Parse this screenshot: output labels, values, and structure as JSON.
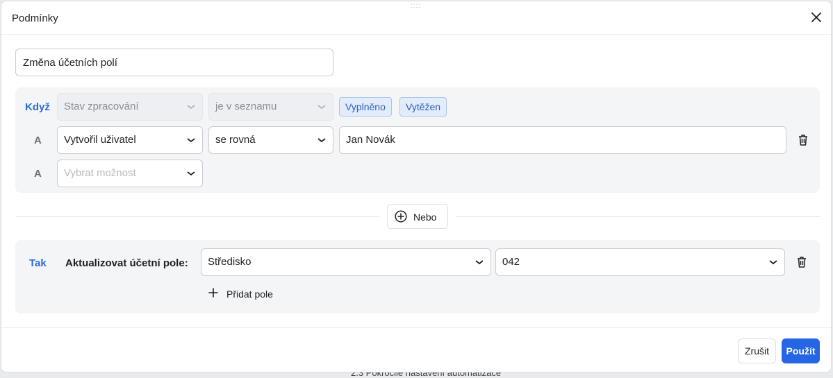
{
  "background": {
    "partial_text": "2.3 Pokročilé nastavení automatizace"
  },
  "dialog": {
    "title": "Podmínky",
    "rule_name": "Změna účetních polí"
  },
  "conditions": {
    "when_keyword": "Když",
    "rows": [
      {
        "field": "Stav zpracování",
        "operator": "je v seznamu",
        "values": [
          "Vyplněno",
          "Vytěžen"
        ],
        "disabled": true
      },
      {
        "connector": "A",
        "field": "Vytvořil uživatel",
        "operator": "se rovná",
        "value": "Jan Novák"
      },
      {
        "connector": "A",
        "placeholder": "Vybrat možnost"
      }
    ]
  },
  "or_button": {
    "label": "Nebo"
  },
  "actions": {
    "then_keyword": "Tak",
    "action_label": "Aktualizovat účetní pole:",
    "field": "Středisko",
    "value": "042",
    "add_field_label": "Přidat pole"
  },
  "footer": {
    "cancel_label": "Zrušit",
    "apply_label": "Použít"
  },
  "colors": {
    "accent": "#2665e3",
    "keyword": "#2b6bd6",
    "chip_bg": "#e2ecfb",
    "panel_bg": "#f4f5f7"
  },
  "icons": [
    "close-icon",
    "chevron-down-icon",
    "trash-icon",
    "plus-circle-icon",
    "plus-icon",
    "drag-handle-icon"
  ]
}
